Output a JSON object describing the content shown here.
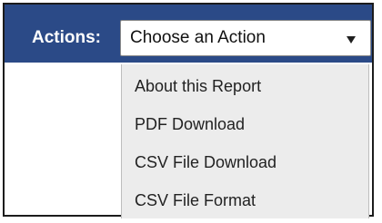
{
  "actions": {
    "label": "Actions:",
    "select": {
      "selected": "Choose an Action",
      "options": [
        "About this Report",
        "PDF Download",
        "CSV File Download",
        "CSV File Format"
      ]
    }
  },
  "colors": {
    "header_bg": "#2b4a87",
    "menu_bg": "#ececec",
    "text_on_header": "#ffffff"
  }
}
